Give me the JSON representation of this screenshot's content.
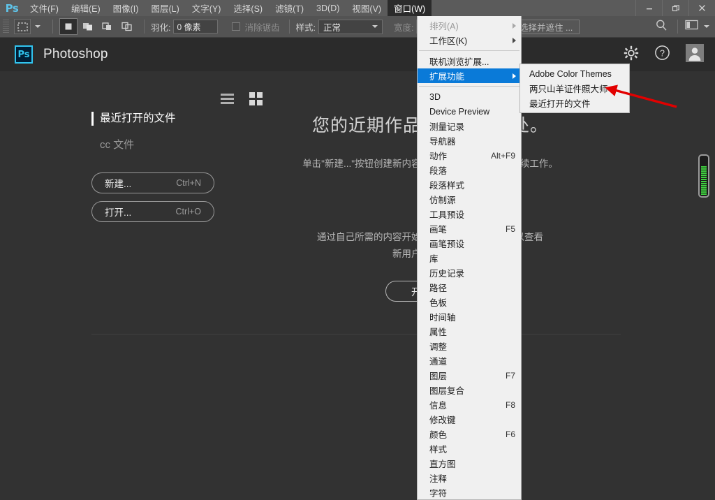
{
  "app": {
    "logo": "Ps",
    "title": "Photoshop"
  },
  "menubar": {
    "items": [
      {
        "label": "文件(F)",
        "active": false
      },
      {
        "label": "编辑(E)",
        "active": false
      },
      {
        "label": "图像(I)",
        "active": false
      },
      {
        "label": "图层(L)",
        "active": false
      },
      {
        "label": "文字(Y)",
        "active": false
      },
      {
        "label": "选择(S)",
        "active": false
      },
      {
        "label": "滤镜(T)",
        "active": false
      },
      {
        "label": "3D(D)",
        "active": false
      },
      {
        "label": "视图(V)",
        "active": false
      },
      {
        "label": "窗口(W)",
        "active": true
      }
    ],
    "window_controls": [
      "minimize-icon",
      "restore-icon",
      "close-icon"
    ]
  },
  "optionsbar": {
    "tool_icon": "rectangular-marquee-icon",
    "selection_modes": [
      "new-selection-icon",
      "add-to-selection-icon",
      "subtract-from-selection-icon",
      "intersect-selection-icon"
    ],
    "feather_label": "羽化:",
    "feather_value": "0 像素",
    "antialias_label": "消除锯齿",
    "antialias_checked": false,
    "style_label": "样式:",
    "style_value": "正常",
    "width_label": "宽度:",
    "width_value": "",
    "select_and_mask": "选择并遮住 ...",
    "search_icon": "search-icon",
    "workspace_icon": "workspace-switcher-icon"
  },
  "startscreen": {
    "view_list_icon": "list-view-icon",
    "view_grid_icon": "grid-view-icon",
    "header_icons": [
      "gear-icon",
      "help-icon",
      "user-avatar-icon"
    ],
    "sidebar": {
      "recent_title": "最近打开的文件",
      "cc_files": "cc 文件",
      "buttons": [
        {
          "label": "新建...",
          "shortcut": "Ctrl+N"
        },
        {
          "label": "打开...",
          "shortcut": "Ctrl+O"
        }
      ]
    },
    "main": {
      "heading": "您的近期作品将显示在此处。",
      "sub_line": "单击\"新建...\"按钮创建新内容，或单击\"打开...\"按钮继续工作。",
      "sub2_line1": "通过自己所需的内容开始使用。选择下面的类别以查看",
      "sub2_line2": "新用户入门教程。",
      "start_button": "开始使用"
    }
  },
  "dropdown": {
    "name": "窗口(W)",
    "items": [
      {
        "label": "排列(A)",
        "shortcut": "",
        "submenu": true,
        "disabled": true,
        "selected": false
      },
      {
        "label": "工作区(K)",
        "shortcut": "",
        "submenu": true,
        "disabled": false,
        "selected": false
      },
      {
        "separator": true
      },
      {
        "label": "联机浏览扩展...",
        "shortcut": "",
        "submenu": false,
        "disabled": false,
        "selected": false
      },
      {
        "label": "扩展功能",
        "shortcut": "",
        "submenu": true,
        "disabled": false,
        "selected": true
      },
      {
        "separator": true
      },
      {
        "label": "3D",
        "shortcut": "",
        "submenu": false,
        "disabled": false,
        "selected": false
      },
      {
        "label": "Device Preview",
        "shortcut": "",
        "submenu": false,
        "disabled": false,
        "selected": false
      },
      {
        "label": "测量记录",
        "shortcut": "",
        "submenu": false,
        "disabled": false,
        "selected": false
      },
      {
        "label": "导航器",
        "shortcut": "",
        "submenu": false,
        "disabled": false,
        "selected": false
      },
      {
        "label": "动作",
        "shortcut": "Alt+F9",
        "submenu": false,
        "disabled": false,
        "selected": false
      },
      {
        "label": "段落",
        "shortcut": "",
        "submenu": false,
        "disabled": false,
        "selected": false
      },
      {
        "label": "段落样式",
        "shortcut": "",
        "submenu": false,
        "disabled": false,
        "selected": false
      },
      {
        "label": "仿制源",
        "shortcut": "",
        "submenu": false,
        "disabled": false,
        "selected": false
      },
      {
        "label": "工具预设",
        "shortcut": "",
        "submenu": false,
        "disabled": false,
        "selected": false
      },
      {
        "label": "画笔",
        "shortcut": "F5",
        "submenu": false,
        "disabled": false,
        "selected": false
      },
      {
        "label": "画笔预设",
        "shortcut": "",
        "submenu": false,
        "disabled": false,
        "selected": false
      },
      {
        "label": "库",
        "shortcut": "",
        "submenu": false,
        "disabled": false,
        "selected": false
      },
      {
        "label": "历史记录",
        "shortcut": "",
        "submenu": false,
        "disabled": false,
        "selected": false
      },
      {
        "label": "路径",
        "shortcut": "",
        "submenu": false,
        "disabled": false,
        "selected": false
      },
      {
        "label": "色板",
        "shortcut": "",
        "submenu": false,
        "disabled": false,
        "selected": false
      },
      {
        "label": "时间轴",
        "shortcut": "",
        "submenu": false,
        "disabled": false,
        "selected": false
      },
      {
        "label": "属性",
        "shortcut": "",
        "submenu": false,
        "disabled": false,
        "selected": false
      },
      {
        "label": "调整",
        "shortcut": "",
        "submenu": false,
        "disabled": false,
        "selected": false
      },
      {
        "label": "通道",
        "shortcut": "",
        "submenu": false,
        "disabled": false,
        "selected": false
      },
      {
        "label": "图层",
        "shortcut": "F7",
        "submenu": false,
        "disabled": false,
        "selected": false
      },
      {
        "label": "图层复合",
        "shortcut": "",
        "submenu": false,
        "disabled": false,
        "selected": false
      },
      {
        "label": "信息",
        "shortcut": "F8",
        "submenu": false,
        "disabled": false,
        "selected": false
      },
      {
        "label": "修改键",
        "shortcut": "",
        "submenu": false,
        "disabled": false,
        "selected": false
      },
      {
        "label": "颜色",
        "shortcut": "F6",
        "submenu": false,
        "disabled": false,
        "selected": false
      },
      {
        "label": "样式",
        "shortcut": "",
        "submenu": false,
        "disabled": false,
        "selected": false
      },
      {
        "label": "直方图",
        "shortcut": "",
        "submenu": false,
        "disabled": false,
        "selected": false
      },
      {
        "label": "注释",
        "shortcut": "",
        "submenu": false,
        "disabled": false,
        "selected": false
      },
      {
        "label": "字符",
        "shortcut": "",
        "submenu": false,
        "disabled": false,
        "selected": false
      }
    ]
  },
  "submenu": {
    "parent": "扩展功能",
    "items": [
      {
        "label": "Adobe Color Themes"
      },
      {
        "label": "两只山羊证件照大师"
      },
      {
        "label": "最近打开的文件"
      }
    ]
  },
  "annotation": {
    "type": "arrow",
    "color": "#e20000",
    "points_at": "两只山羊证件照大师"
  },
  "colors": {
    "menubar_bg": "#5b5b5b",
    "optionsbar_bg": "#535353",
    "canvas_bg": "#323232",
    "menu_bg": "#f0f0f0",
    "highlight": "#0a7ad8",
    "accent_blue": "#31c5f0",
    "annotation_red": "#e20000"
  }
}
